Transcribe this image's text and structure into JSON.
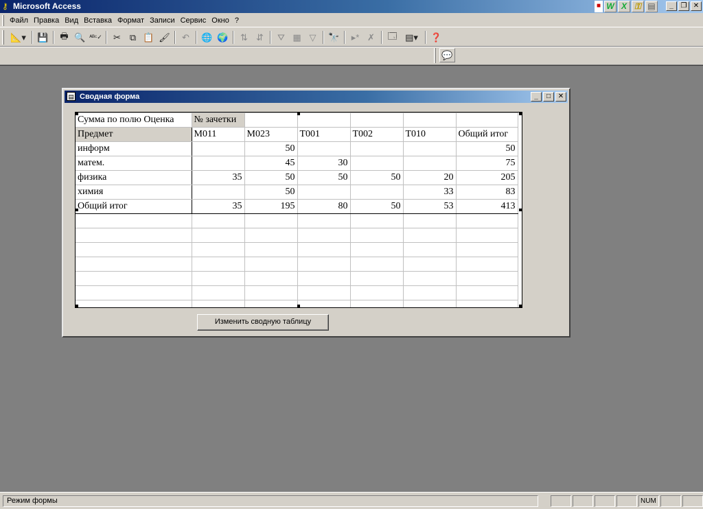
{
  "app": {
    "title": "Microsoft Access",
    "office_icons": [
      "word-icon",
      "excel-icon",
      "key-icon",
      "doc-icon"
    ]
  },
  "menu": {
    "items": [
      {
        "label": "Файл"
      },
      {
        "label": "Правка"
      },
      {
        "label": "Вид"
      },
      {
        "label": "Вставка"
      },
      {
        "label": "Формат"
      },
      {
        "label": "Записи"
      },
      {
        "label": "Сервис"
      },
      {
        "label": "Окно"
      },
      {
        "label": "?"
      }
    ]
  },
  "toolbar": {
    "icons": [
      "design-view-icon",
      "save-icon",
      "print-icon",
      "print-preview-icon",
      "spelling-icon",
      "cut-icon",
      "copy-icon",
      "paste-icon",
      "format-painter-icon",
      "undo-icon",
      "hyperlink-icon",
      "web-icon",
      "sort-ascending-icon",
      "sort-descending-icon",
      "filter-by-selection-icon",
      "filter-by-form-icon",
      "apply-filter-icon",
      "find-icon",
      "new-record-icon",
      "delete-record-icon",
      "database-window-icon",
      "new-object-icon",
      "help-icon"
    ]
  },
  "form": {
    "title": "Сводная форма",
    "button_label": "Изменить сводную таблицу"
  },
  "pivot": {
    "data_field": "Сумма по полю Оценка",
    "column_field": "№ зачетки",
    "row_field": "Предмет",
    "columns": [
      "M011",
      "M023",
      "T001",
      "T002",
      "T010",
      "Общий итог"
    ],
    "rows": [
      {
        "label": "информ",
        "values": [
          "",
          "50",
          "",
          "",
          "",
          "50"
        ]
      },
      {
        "label": "матем.",
        "values": [
          "",
          "45",
          "30",
          "",
          "",
          "75"
        ]
      },
      {
        "label": "физика",
        "values": [
          "35",
          "50",
          "50",
          "50",
          "20",
          "205"
        ]
      },
      {
        "label": "химия",
        "values": [
          "",
          "50",
          "",
          "",
          "33",
          "83"
        ]
      }
    ],
    "total": {
      "label": "Общий итог",
      "values": [
        "35",
        "195",
        "80",
        "50",
        "53",
        "413"
      ]
    }
  },
  "status": {
    "text": "Режим формы",
    "num": "NUM"
  }
}
